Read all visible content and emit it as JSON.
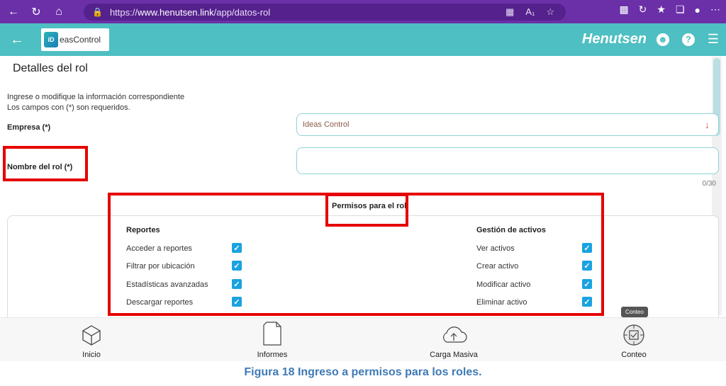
{
  "browser": {
    "url_scheme": "https://",
    "url_host": "www.henutsen.link",
    "url_path": "/app/datos-rol"
  },
  "appbar": {
    "logo_text": "easControl",
    "logo_mark": "iD",
    "brand": "Henutsen"
  },
  "page": {
    "title": "Detalles del rol",
    "intro_line1": "Ingrese o modifique la información correspondiente",
    "intro_line2": "Los campos con (*) son requeridos."
  },
  "form": {
    "empresa_label": "Empresa (*)",
    "empresa_value": "Ideas Control",
    "nombre_label": "Nombre del rol (*)",
    "nombre_value": "",
    "nombre_counter": "0/30"
  },
  "permissions": {
    "title": "Permisos para el rol",
    "groups": [
      {
        "title": "Reportes",
        "items": [
          {
            "label": "Acceder a reportes",
            "checked": true
          },
          {
            "label": "Filtrar por ubicación",
            "checked": true
          },
          {
            "label": "Estadísticas avanzadas",
            "checked": true
          },
          {
            "label": "Descargar reportes",
            "checked": true
          }
        ]
      },
      {
        "title": "Gestión de activos",
        "items": [
          {
            "label": "Ver activos",
            "checked": true
          },
          {
            "label": "Crear activo",
            "checked": true
          },
          {
            "label": "Modificar activo",
            "checked": true
          },
          {
            "label": "Eliminar activo",
            "checked": true
          }
        ]
      }
    ]
  },
  "bottom_nav": {
    "items": [
      "Inicio",
      "Informes",
      "Carga Masiva",
      "Conteo"
    ],
    "tooltip": "Conteo"
  },
  "caption": "Figura 18 Ingreso a permisos para los roles.",
  "colors": {
    "browser": "#6b2fa8",
    "appbar": "#4ebfc2",
    "highlight": "#e60000",
    "checkbox": "#1ba2e0",
    "caption": "#3f7ab6"
  }
}
